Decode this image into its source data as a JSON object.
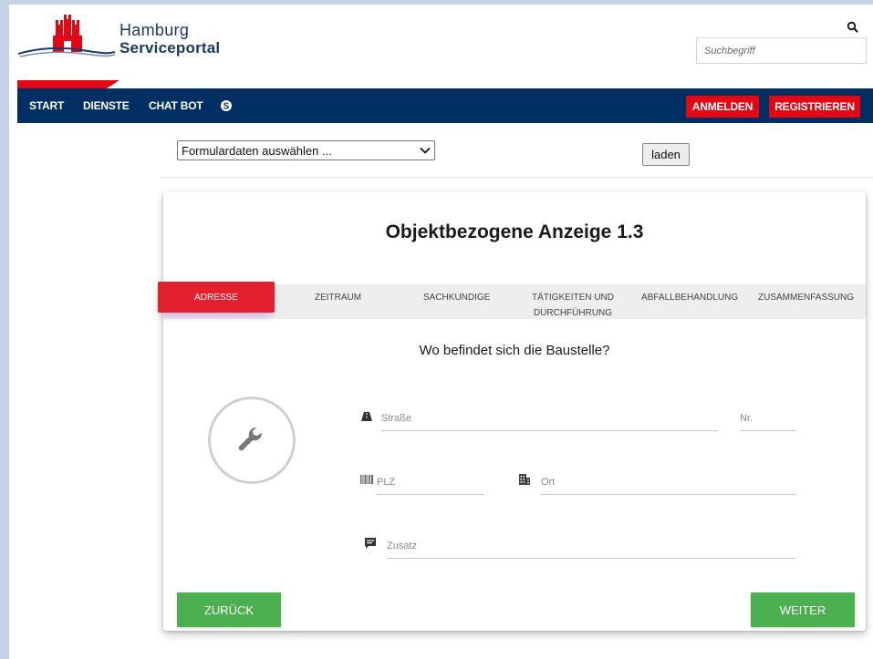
{
  "header": {
    "logo_line1": "Hamburg",
    "logo_line2": "Serviceportal",
    "search_placeholder": "Suchbegriff",
    "search_icon": "search-icon"
  },
  "nav": {
    "items": [
      "START",
      "DIENSTE",
      "CHAT BOT"
    ],
    "skype_icon": "skype-icon",
    "login_label": "ANMELDEN",
    "register_label": "REGISTRIEREN",
    "colors": {
      "navy": "#003063",
      "red": "#e30613"
    }
  },
  "formdata": {
    "select_value": "Formulardaten auswählen ...",
    "load_label": "laden"
  },
  "form": {
    "title": "Objektbezogene Anzeige 1.3",
    "steps": [
      {
        "label": "ADRESSE",
        "active": true
      },
      {
        "label": "ZEITRAUM"
      },
      {
        "label": "SACHKUNDIGE"
      },
      {
        "label": "TÄTIGKEITEN UND",
        "label2": "DURCHFÜHRUNG"
      },
      {
        "label": "ABFALLBEHANDLUNG"
      },
      {
        "label": "ZUSAMMENFASSUNG"
      }
    ],
    "question": "Wo befindet sich die Baustelle?",
    "fields": {
      "street_placeholder": "Straße",
      "number_placeholder": "Nr.",
      "zip_placeholder": "PLZ",
      "city_placeholder": "Ort",
      "extra_placeholder": "Zusatz"
    },
    "back_label": "ZURÜCK",
    "next_label": "WEITER",
    "colors": {
      "active_step": "#e5202e",
      "button_green": "#4caf50"
    }
  }
}
